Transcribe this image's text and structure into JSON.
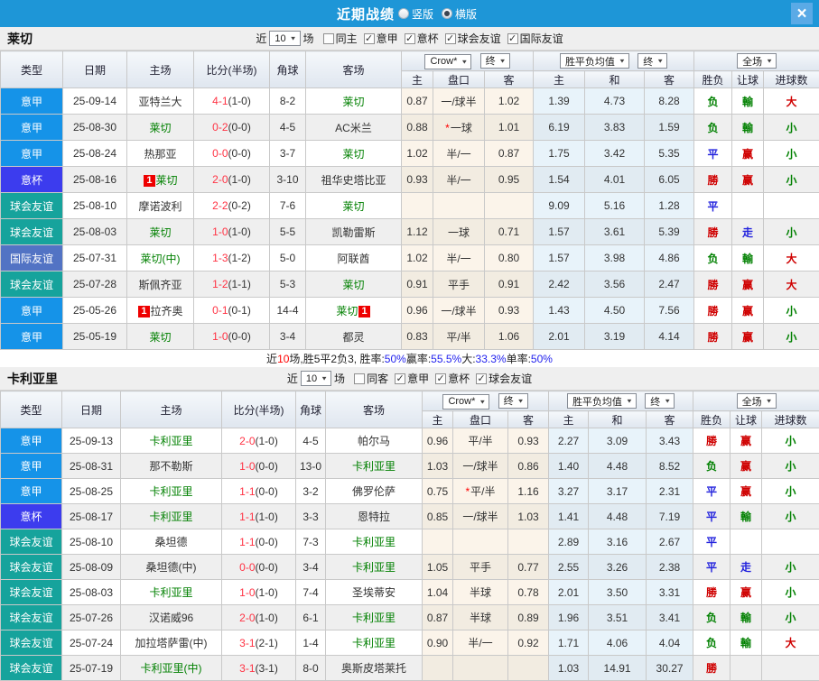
{
  "header": {
    "title": "近期战绩",
    "view_options": [
      {
        "label": "竖版",
        "selected": false
      },
      {
        "label": "横版",
        "selected": true
      }
    ],
    "close_glyph": "×"
  },
  "colors": {
    "topbar": "#1e96d7",
    "close_button": "#5aaae6",
    "win_red": "#cf0000",
    "loss_green": "#008000",
    "draw_blue": "#2222dd",
    "score_red": "#ff3344",
    "crow_col_bg": "#fbf4ea",
    "mean_col_bg": "#e8f3fa"
  },
  "type_styles": {
    "意甲": "#1593e8",
    "意杯": "#3c3cee",
    "球会友谊": "#16a39c",
    "国际友谊": "#5273c4"
  },
  "columns": [
    "类型",
    "日期",
    "主场",
    "比分(半场)",
    "角球",
    "客场",
    "主",
    "盘口",
    "客",
    "主",
    "和",
    "客",
    "胜负",
    "让球",
    "进球数"
  ],
  "controls": {
    "near": "近",
    "count": "10",
    "matches": "场",
    "odds_source": "Crow*",
    "stage1": "终",
    "mean": "胜平负均值",
    "stage2": "终",
    "scope": "全场"
  },
  "sections": [
    {
      "team": "莱切",
      "filter": {
        "checkboxes": [
          {
            "label": "同主",
            "checked": false
          },
          {
            "label": "意甲",
            "checked": true
          },
          {
            "label": "意杯",
            "checked": true
          },
          {
            "label": "球会友谊",
            "checked": true
          },
          {
            "label": "国际友谊",
            "checked": true
          }
        ]
      },
      "rows": [
        {
          "type": "意甲",
          "date": "25-09-14",
          "home": {
            "name": "亚特兰大"
          },
          "score": "4-1",
          "half": "(1-0)",
          "corner": "8-2",
          "away": {
            "name": "莱切",
            "green": true
          },
          "odds": {
            "h": "0.87",
            "line": "一/球半",
            "a": "1.02"
          },
          "mean": [
            "1.39",
            "4.73",
            "8.28"
          ],
          "res": [
            {
              "t": "负",
              "c": "g"
            },
            {
              "t": "輸",
              "c": "g"
            },
            {
              "t": "大",
              "c": "r"
            }
          ]
        },
        {
          "type": "意甲",
          "date": "25-08-30",
          "home": {
            "name": "莱切",
            "green": true
          },
          "score": "0-2",
          "half": "(0-0)",
          "corner": "4-5",
          "away": {
            "name": "AC米兰"
          },
          "odds": {
            "h": "0.88",
            "line": "一球",
            "star": true,
            "a": "1.01"
          },
          "mean": [
            "6.19",
            "3.83",
            "1.59"
          ],
          "res": [
            {
              "t": "负",
              "c": "g"
            },
            {
              "t": "輸",
              "c": "g"
            },
            {
              "t": "小",
              "c": "g"
            }
          ]
        },
        {
          "type": "意甲",
          "date": "25-08-24",
          "home": {
            "name": "热那亚"
          },
          "score": "0-0",
          "half": "(0-0)",
          "corner": "3-7",
          "away": {
            "name": "莱切",
            "green": true
          },
          "odds": {
            "h": "1.02",
            "line": "半/一",
            "a": "0.87"
          },
          "mean": [
            "1.75",
            "3.42",
            "5.35"
          ],
          "res": [
            {
              "t": "平",
              "c": "b"
            },
            {
              "t": "赢",
              "c": "r"
            },
            {
              "t": "小",
              "c": "g"
            }
          ]
        },
        {
          "type": "意杯",
          "date": "25-08-16",
          "home": {
            "name": "莱切",
            "green": true,
            "badge": "1"
          },
          "score": "2-0",
          "half": "(1-0)",
          "corner": "3-10",
          "away": {
            "name": "祖华史塔比亚"
          },
          "odds": {
            "h": "0.93",
            "line": "半/一",
            "a": "0.95"
          },
          "mean": [
            "1.54",
            "4.01",
            "6.05"
          ],
          "res": [
            {
              "t": "勝",
              "c": "r"
            },
            {
              "t": "赢",
              "c": "r"
            },
            {
              "t": "小",
              "c": "g"
            }
          ]
        },
        {
          "type": "球会友谊",
          "date": "25-08-10",
          "home": {
            "name": "摩诺波利"
          },
          "score": "2-2",
          "half": "(0-2)",
          "corner": "7-6",
          "away": {
            "name": "莱切",
            "green": true
          },
          "odds": null,
          "mean": [
            "9.09",
            "5.16",
            "1.28"
          ],
          "res": [
            {
              "t": "平",
              "c": "b"
            },
            {
              "t": "",
              "c": ""
            },
            {
              "t": "",
              "c": ""
            }
          ]
        },
        {
          "type": "球会友谊",
          "date": "25-08-03",
          "home": {
            "name": "莱切",
            "green": true
          },
          "score": "1-0",
          "half": "(1-0)",
          "corner": "5-5",
          "away": {
            "name": "凯勒雷斯"
          },
          "odds": {
            "h": "1.12",
            "line": "一球",
            "a": "0.71"
          },
          "mean": [
            "1.57",
            "3.61",
            "5.39"
          ],
          "res": [
            {
              "t": "勝",
              "c": "r"
            },
            {
              "t": "走",
              "c": "b"
            },
            {
              "t": "小",
              "c": "g"
            }
          ]
        },
        {
          "type": "国际友谊",
          "date": "25-07-31",
          "home": {
            "name": "莱切(中)",
            "green": true
          },
          "score": "1-3",
          "half": "(1-2)",
          "corner": "5-0",
          "away": {
            "name": "阿联酋"
          },
          "odds": {
            "h": "1.02",
            "line": "半/一",
            "a": "0.80"
          },
          "mean": [
            "1.57",
            "3.98",
            "4.86"
          ],
          "res": [
            {
              "t": "负",
              "c": "g"
            },
            {
              "t": "輸",
              "c": "g"
            },
            {
              "t": "大",
              "c": "r"
            }
          ]
        },
        {
          "type": "球会友谊",
          "date": "25-07-28",
          "home": {
            "name": "斯佩齐亚"
          },
          "score": "1-2",
          "half": "(1-1)",
          "corner": "5-3",
          "away": {
            "name": "莱切",
            "green": true
          },
          "odds": {
            "h": "0.91",
            "line": "平手",
            "a": "0.91"
          },
          "mean": [
            "2.42",
            "3.56",
            "2.47"
          ],
          "res": [
            {
              "t": "勝",
              "c": "r"
            },
            {
              "t": "赢",
              "c": "r"
            },
            {
              "t": "大",
              "c": "r"
            }
          ]
        },
        {
          "type": "意甲",
          "date": "25-05-26",
          "home": {
            "name": "拉齐奥",
            "badge": "1"
          },
          "score": "0-1",
          "half": "(0-1)",
          "corner": "14-4",
          "away": {
            "name": "莱切",
            "green": true,
            "badge": "1"
          },
          "odds": {
            "h": "0.96",
            "line": "一/球半",
            "a": "0.93"
          },
          "mean": [
            "1.43",
            "4.50",
            "7.56"
          ],
          "res": [
            {
              "t": "勝",
              "c": "r"
            },
            {
              "t": "赢",
              "c": "r"
            },
            {
              "t": "小",
              "c": "g"
            }
          ]
        },
        {
          "type": "意甲",
          "date": "25-05-19",
          "home": {
            "name": "莱切",
            "green": true
          },
          "score": "1-0",
          "half": "(0-0)",
          "corner": "3-4",
          "away": {
            "name": "都灵"
          },
          "odds": {
            "h": "0.83",
            "line": "平/半",
            "a": "1.06"
          },
          "mean": [
            "2.01",
            "3.19",
            "4.14"
          ],
          "res": [
            {
              "t": "勝",
              "c": "r"
            },
            {
              "t": "赢",
              "c": "r"
            },
            {
              "t": "小",
              "c": "g"
            }
          ]
        }
      ],
      "summary": [
        {
          "t": "近",
          "c": "k"
        },
        {
          "t": "10",
          "c": "r"
        },
        {
          "t": "场,胜5平2负3, 胜率:",
          "c": "k"
        },
        {
          "t": "50%",
          "c": "b"
        },
        {
          "t": " 赢率:",
          "c": "k"
        },
        {
          "t": "55.5%",
          "c": "b"
        },
        {
          "t": " 大:",
          "c": "k"
        },
        {
          "t": "33.3%",
          "c": "b"
        },
        {
          "t": " 单率:",
          "c": "k"
        },
        {
          "t": "50%",
          "c": "b"
        }
      ]
    },
    {
      "team": "卡利亚里",
      "filter": {
        "checkboxes": [
          {
            "label": "同客",
            "checked": false
          },
          {
            "label": "意甲",
            "checked": true
          },
          {
            "label": "意杯",
            "checked": true
          },
          {
            "label": "球会友谊",
            "checked": true
          }
        ]
      },
      "rows": [
        {
          "type": "意甲",
          "date": "25-09-13",
          "home": {
            "name": "卡利亚里",
            "green": true
          },
          "score": "2-0",
          "half": "(1-0)",
          "corner": "4-5",
          "away": {
            "name": "帕尔马"
          },
          "odds": {
            "h": "0.96",
            "line": "平/半",
            "a": "0.93"
          },
          "mean": [
            "2.27",
            "3.09",
            "3.43"
          ],
          "res": [
            {
              "t": "勝",
              "c": "r"
            },
            {
              "t": "赢",
              "c": "r"
            },
            {
              "t": "小",
              "c": "g"
            }
          ]
        },
        {
          "type": "意甲",
          "date": "25-08-31",
          "home": {
            "name": "那不勒斯"
          },
          "score": "1-0",
          "half": "(0-0)",
          "corner": "13-0",
          "away": {
            "name": "卡利亚里",
            "green": true
          },
          "odds": {
            "h": "1.03",
            "line": "一/球半",
            "a": "0.86"
          },
          "mean": [
            "1.40",
            "4.48",
            "8.52"
          ],
          "res": [
            {
              "t": "负",
              "c": "g"
            },
            {
              "t": "赢",
              "c": "r"
            },
            {
              "t": "小",
              "c": "g"
            }
          ]
        },
        {
          "type": "意甲",
          "date": "25-08-25",
          "home": {
            "name": "卡利亚里",
            "green": true
          },
          "score": "1-1",
          "half": "(0-0)",
          "corner": "3-2",
          "away": {
            "name": "佛罗伦萨"
          },
          "odds": {
            "h": "0.75",
            "line": "平/半",
            "star": true,
            "a": "1.16"
          },
          "mean": [
            "3.27",
            "3.17",
            "2.31"
          ],
          "res": [
            {
              "t": "平",
              "c": "b"
            },
            {
              "t": "赢",
              "c": "r"
            },
            {
              "t": "小",
              "c": "g"
            }
          ]
        },
        {
          "type": "意杯",
          "date": "25-08-17",
          "home": {
            "name": "卡利亚里",
            "green": true
          },
          "score": "1-1",
          "half": "(1-0)",
          "corner": "3-3",
          "away": {
            "name": "恩特拉"
          },
          "odds": {
            "h": "0.85",
            "line": "一/球半",
            "a": "1.03"
          },
          "mean": [
            "1.41",
            "4.48",
            "7.19"
          ],
          "res": [
            {
              "t": "平",
              "c": "b"
            },
            {
              "t": "輸",
              "c": "g"
            },
            {
              "t": "小",
              "c": "g"
            }
          ]
        },
        {
          "type": "球会友谊",
          "date": "25-08-10",
          "home": {
            "name": "桑坦德"
          },
          "score": "1-1",
          "half": "(0-0)",
          "corner": "7-3",
          "away": {
            "name": "卡利亚里",
            "green": true
          },
          "odds": null,
          "mean": [
            "2.89",
            "3.16",
            "2.67"
          ],
          "res": [
            {
              "t": "平",
              "c": "b"
            },
            {
              "t": "",
              "c": ""
            },
            {
              "t": "",
              "c": ""
            }
          ]
        },
        {
          "type": "球会友谊",
          "date": "25-08-09",
          "home": {
            "name": "桑坦德(中)"
          },
          "score": "0-0",
          "half": "(0-0)",
          "corner": "3-4",
          "away": {
            "name": "卡利亚里",
            "green": true
          },
          "odds": {
            "h": "1.05",
            "line": "平手",
            "a": "0.77"
          },
          "mean": [
            "2.55",
            "3.26",
            "2.38"
          ],
          "res": [
            {
              "t": "平",
              "c": "b"
            },
            {
              "t": "走",
              "c": "b"
            },
            {
              "t": "小",
              "c": "g"
            }
          ]
        },
        {
          "type": "球会友谊",
          "date": "25-08-03",
          "home": {
            "name": "卡利亚里",
            "green": true
          },
          "score": "1-0",
          "half": "(1-0)",
          "corner": "7-4",
          "away": {
            "name": "圣埃蒂安"
          },
          "odds": {
            "h": "1.04",
            "line": "半球",
            "a": "0.78"
          },
          "mean": [
            "2.01",
            "3.50",
            "3.31"
          ],
          "res": [
            {
              "t": "勝",
              "c": "r"
            },
            {
              "t": "赢",
              "c": "r"
            },
            {
              "t": "小",
              "c": "g"
            }
          ]
        },
        {
          "type": "球会友谊",
          "date": "25-07-26",
          "home": {
            "name": "汉诺威96"
          },
          "score": "2-0",
          "half": "(1-0)",
          "corner": "6-1",
          "away": {
            "name": "卡利亚里",
            "green": true
          },
          "odds": {
            "h": "0.87",
            "line": "半球",
            "a": "0.89"
          },
          "mean": [
            "1.96",
            "3.51",
            "3.41"
          ],
          "res": [
            {
              "t": "负",
              "c": "g"
            },
            {
              "t": "輸",
              "c": "g"
            },
            {
              "t": "小",
              "c": "g"
            }
          ]
        },
        {
          "type": "球会友谊",
          "date": "25-07-24",
          "home": {
            "name": "加拉塔萨雷(中)"
          },
          "score": "3-1",
          "half": "(2-1)",
          "corner": "1-4",
          "away": {
            "name": "卡利亚里",
            "green": true
          },
          "odds": {
            "h": "0.90",
            "line": "半/一",
            "a": "0.92"
          },
          "mean": [
            "1.71",
            "4.06",
            "4.04"
          ],
          "res": [
            {
              "t": "负",
              "c": "g"
            },
            {
              "t": "輸",
              "c": "g"
            },
            {
              "t": "大",
              "c": "r"
            }
          ]
        },
        {
          "type": "球会友谊",
          "date": "25-07-19",
          "home": {
            "name": "卡利亚里(中)",
            "green": true
          },
          "score": "3-1",
          "half": "(3-1)",
          "corner": "8-0",
          "away": {
            "name": "奥斯皮塔莱托"
          },
          "odds": null,
          "mean": [
            "1.03",
            "14.91",
            "30.27"
          ],
          "res": [
            {
              "t": "勝",
              "c": "r"
            },
            {
              "t": "",
              "c": ""
            },
            {
              "t": "",
              "c": ""
            }
          ]
        }
      ],
      "summary": []
    }
  ]
}
